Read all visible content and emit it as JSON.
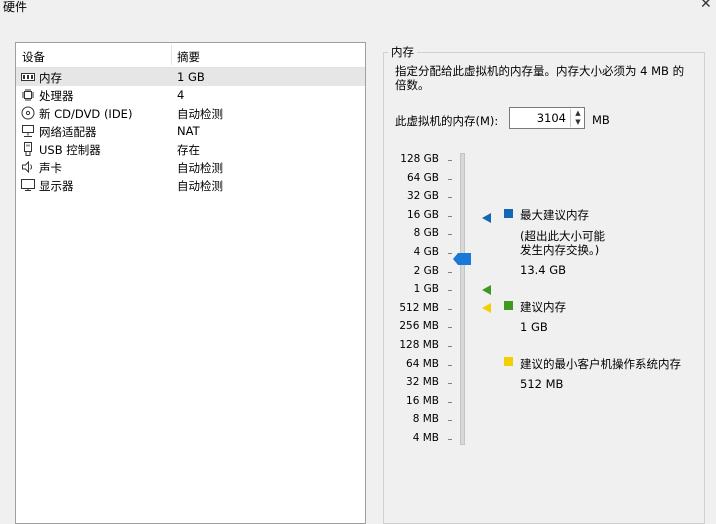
{
  "window": {
    "title": "硬件"
  },
  "devices": {
    "header": {
      "device": "设备",
      "summary": "摘要"
    },
    "items": [
      {
        "name": "内存",
        "summary": "1 GB",
        "icon": "memory-icon",
        "selected": true
      },
      {
        "name": "处理器",
        "summary": "4",
        "icon": "processor-icon"
      },
      {
        "name": "新 CD/DVD (IDE)",
        "summary": "自动检测",
        "icon": "cd-dvd-icon"
      },
      {
        "name": "网络适配器",
        "summary": "NAT",
        "icon": "network-adapter-icon"
      },
      {
        "name": "USB 控制器",
        "summary": "存在",
        "icon": "usb-icon"
      },
      {
        "name": "声卡",
        "summary": "自动检测",
        "icon": "sound-card-icon"
      },
      {
        "name": "显示器",
        "summary": "自动检测",
        "icon": "display-icon"
      }
    ]
  },
  "memory": {
    "group_title": "内存",
    "description": "指定分配给此虚拟机的内存量。内存大小必须为 4 MB 的倍数。",
    "field_label": "此虚拟机的内存(M):",
    "value": "3104",
    "unit": "MB",
    "scale_labels": [
      "128 GB",
      "64 GB",
      "32 GB",
      "16 GB",
      "8 GB",
      "4 GB",
      "2 GB",
      "1 GB",
      "512 MB",
      "256 MB",
      "128 MB",
      "64 MB",
      "32 MB",
      "16 MB",
      "8 MB",
      "4 MB"
    ],
    "legend": {
      "max": {
        "title": "最大建议内存",
        "note1": "(超出此大小可能",
        "note2": "发生内存交换。)",
        "value": "13.4 GB",
        "color": "#1467b4"
      },
      "recommended": {
        "title": "建议内存",
        "value": "1 GB",
        "color": "#3d9a1e"
      },
      "min": {
        "title": "建议的最小客户机操作系统内存",
        "value": "512 MB",
        "color": "#f2d000"
      }
    },
    "thumb_color": "#1a78d6"
  }
}
